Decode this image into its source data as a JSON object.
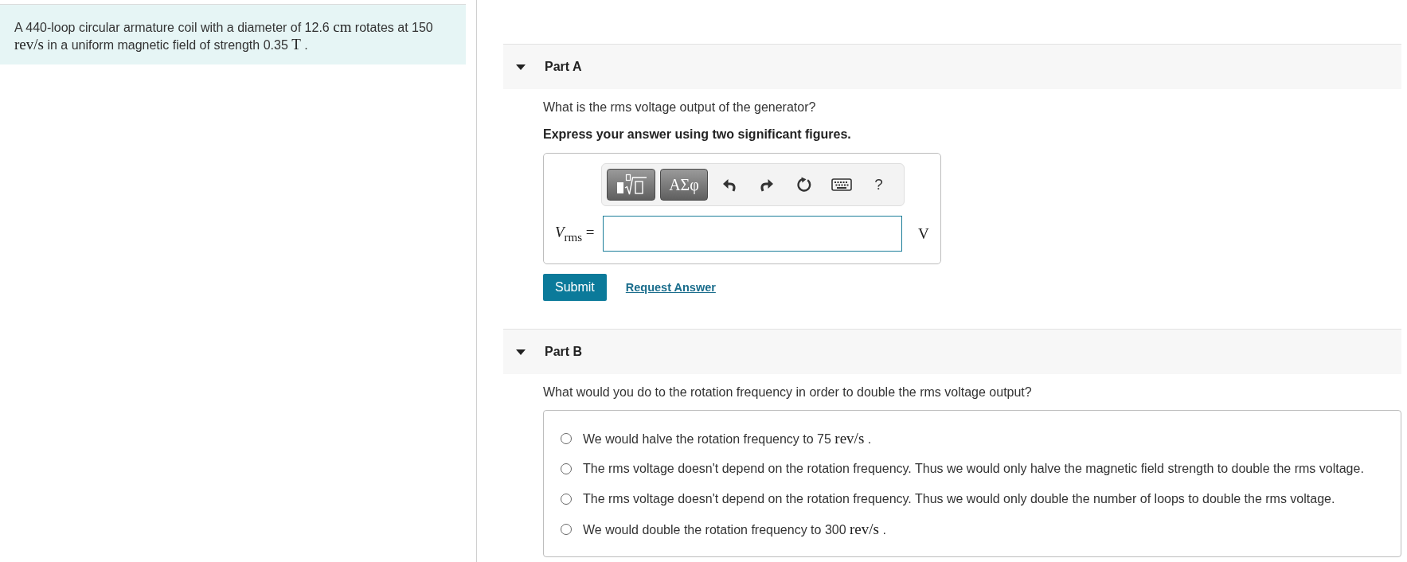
{
  "problem": {
    "segments": [
      {
        "kind": "text",
        "text": "A 440-loop circular armature coil with a diameter of 12.6 "
      },
      {
        "kind": "math",
        "text": "cm"
      },
      {
        "kind": "text",
        "text": " rotates at 150 "
      },
      {
        "kind": "math",
        "text": "rev/s"
      },
      {
        "kind": "text",
        "text": " in a uniform magnetic field of strength 0.35 "
      },
      {
        "kind": "math",
        "text": "T"
      },
      {
        "kind": "text",
        "text": " ."
      }
    ]
  },
  "parts": [
    {
      "kind": "numeric",
      "title": "Part A",
      "expanded": true,
      "question": "What is the rms voltage output of the generator?",
      "instruction": "Express your answer using two significant figures.",
      "toolbar": {
        "symbols": "ΑΣφ",
        "help": "?"
      },
      "answer": {
        "label": "*V*$_{rms}$ =",
        "unit": "V"
      },
      "actions": {
        "submit": "Submit",
        "request": "Request Answer"
      }
    },
    {
      "kind": "choice",
      "title": "Part B",
      "expanded": true,
      "question": "What would you do to the rotation frequency in order to double the rms voltage output?",
      "options": [
        {
          "selected": false,
          "segments": [
            {
              "kind": "text",
              "text": "We would halve the rotation frequency to 75 "
            },
            {
              "kind": "math",
              "text": "rev/s"
            },
            {
              "kind": "text",
              "text": " ."
            }
          ]
        },
        {
          "selected": false,
          "segments": [
            {
              "kind": "text",
              "text": "The rms voltage doesn't depend on the rotation frequency. Thus we would only halve the magnetic field strength to double the rms voltage."
            }
          ]
        },
        {
          "selected": false,
          "segments": [
            {
              "kind": "text",
              "text": "The rms voltage doesn't depend on the rotation frequency. Thus we would only double the number of loops to double the rms voltage."
            }
          ]
        },
        {
          "selected": false,
          "segments": [
            {
              "kind": "text",
              "text": "We would double the rotation frequency to 300 "
            },
            {
              "kind": "math",
              "text": "rev/s"
            },
            {
              "kind": "text",
              "text": " ."
            }
          ]
        }
      ]
    }
  ]
}
